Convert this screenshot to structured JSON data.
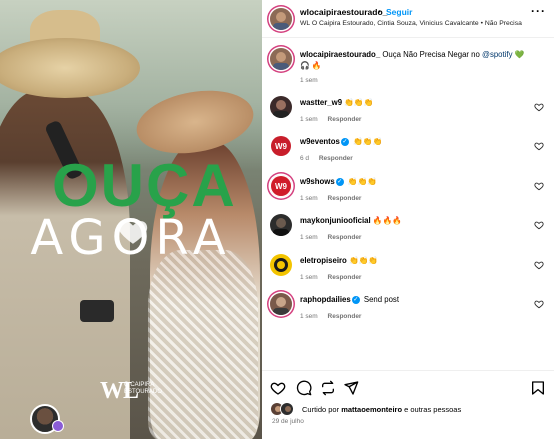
{
  "post": {
    "overlay_line1": "OUÇA",
    "overlay_line2": "AGORA",
    "logo_text": "WL",
    "logo_sub": "O CAIPIRA ESTOURADO"
  },
  "header": {
    "username": "wlocaipiraestourado_",
    "bullet": "•",
    "follow_label": "Seguir",
    "subtitle": "WL O Caipira Estourado, Cintia Souza, Vinicius Cavalcante • Não Precisa",
    "more_label": "···"
  },
  "caption": {
    "username": "wlocaipiraestourado_",
    "text": "Ouça Não Precisa Negar no ",
    "mention": "@spotify",
    "emoji_after": "💚",
    "line2": "🎧 🔥",
    "time": "1 sem"
  },
  "comments": [
    {
      "username": "wastter_w9",
      "verified": false,
      "text": "👏👏👏",
      "time": "1 sem",
      "reply": "Responder",
      "avatar_color": "#3b2a2a"
    },
    {
      "username": "w9eventos",
      "verified": true,
      "text": "👏👏👏",
      "time": "6 d",
      "reply": "Responder",
      "avatar_color": "#c81e2b"
    },
    {
      "username": "w9shows",
      "verified": true,
      "text": "👏👏👏",
      "time": "1 sem",
      "reply": "Responder",
      "avatar_color": "#d01c2a"
    },
    {
      "username": "maykonjuniooficial",
      "verified": false,
      "text": "🔥🔥🔥",
      "time": "1 sem",
      "reply": "Responder",
      "avatar_color": "#2c2c2c"
    },
    {
      "username": "eletropiseiro",
      "verified": false,
      "text": "👏👏👏",
      "time": "1 sem",
      "reply": "Responder",
      "avatar_color": "#f3c400"
    },
    {
      "username": "raphopdailies",
      "verified": true,
      "text": "Send post",
      "time": "1 sem",
      "reply": "Responder",
      "avatar_color": "#7a5a4a"
    }
  ],
  "likes": {
    "prefix": "Curtido por ",
    "user": "mattaoemonteiro",
    "suffix": " e outras pessoas"
  },
  "date": "29 de julho",
  "colors": {
    "accent": "#0095f6",
    "story_ring": "#d4417f",
    "overlay_green": "#28a24a"
  }
}
